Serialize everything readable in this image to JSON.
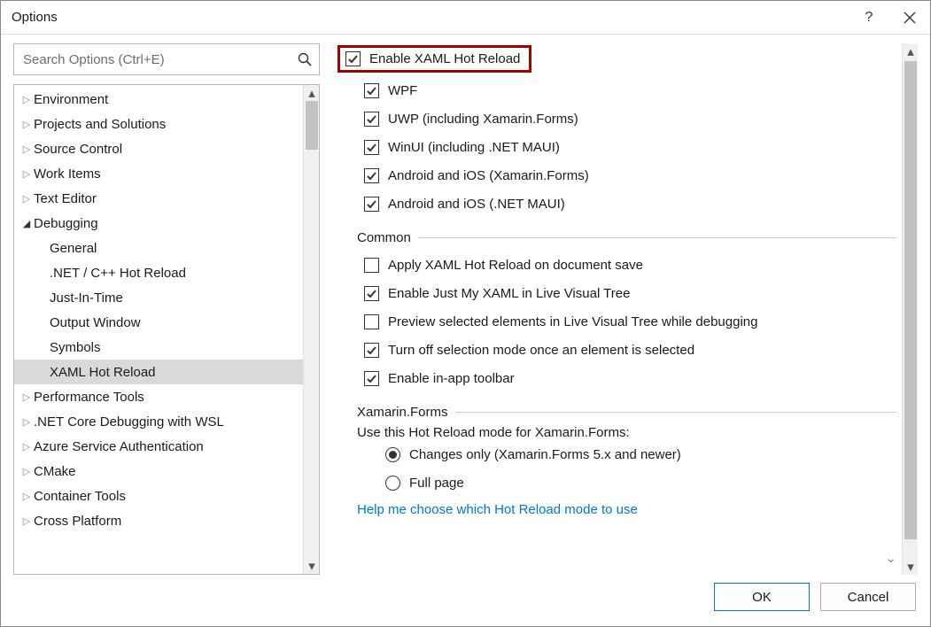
{
  "window": {
    "title": "Options"
  },
  "search": {
    "placeholder": "Search Options (Ctrl+E)"
  },
  "tree": {
    "items": [
      {
        "label": "Environment",
        "kind": "parent"
      },
      {
        "label": "Projects and Solutions",
        "kind": "parent"
      },
      {
        "label": "Source Control",
        "kind": "parent"
      },
      {
        "label": "Work Items",
        "kind": "parent"
      },
      {
        "label": "Text Editor",
        "kind": "parent"
      },
      {
        "label": "Debugging",
        "kind": "parent-expanded"
      },
      {
        "label": "General",
        "kind": "child"
      },
      {
        "label": ".NET / C++ Hot Reload",
        "kind": "child"
      },
      {
        "label": "Just-In-Time",
        "kind": "child"
      },
      {
        "label": "Output Window",
        "kind": "child"
      },
      {
        "label": "Symbols",
        "kind": "child"
      },
      {
        "label": "XAML Hot Reload",
        "kind": "child-selected"
      },
      {
        "label": "Performance Tools",
        "kind": "parent"
      },
      {
        "label": ".NET Core Debugging with WSL",
        "kind": "parent"
      },
      {
        "label": "Azure Service Authentication",
        "kind": "parent"
      },
      {
        "label": "CMake",
        "kind": "parent"
      },
      {
        "label": "Container Tools",
        "kind": "parent"
      },
      {
        "label": "Cross Platform",
        "kind": "parent"
      }
    ]
  },
  "options": {
    "enable_label": "Enable XAML Hot Reload",
    "platforms": [
      {
        "label": "WPF",
        "checked": true
      },
      {
        "label": "UWP (including Xamarin.Forms)",
        "checked": true
      },
      {
        "label": "WinUI (including .NET MAUI)",
        "checked": true
      },
      {
        "label": "Android and iOS (Xamarin.Forms)",
        "checked": true
      },
      {
        "label": "Android and iOS (.NET MAUI)",
        "checked": true
      }
    ],
    "common_header": "Common",
    "common": [
      {
        "label": "Apply XAML Hot Reload on document save",
        "checked": false
      },
      {
        "label": "Enable Just My XAML in Live Visual Tree",
        "checked": true
      },
      {
        "label": "Preview selected elements in Live Visual Tree while debugging",
        "checked": false
      },
      {
        "label": "Turn off selection mode once an element is selected",
        "checked": true
      },
      {
        "label": "Enable in-app toolbar",
        "checked": true
      }
    ],
    "xamarin_header": "Xamarin.Forms",
    "xamarin_prompt": "Use this Hot Reload mode for Xamarin.Forms:",
    "xamarin_radios": [
      {
        "label": "Changes only (Xamarin.Forms 5.x and newer)",
        "checked": true
      },
      {
        "label": "Full page",
        "checked": false
      }
    ],
    "help_link": "Help me choose which Hot Reload mode to use"
  },
  "buttons": {
    "ok": "OK",
    "cancel": "Cancel"
  }
}
